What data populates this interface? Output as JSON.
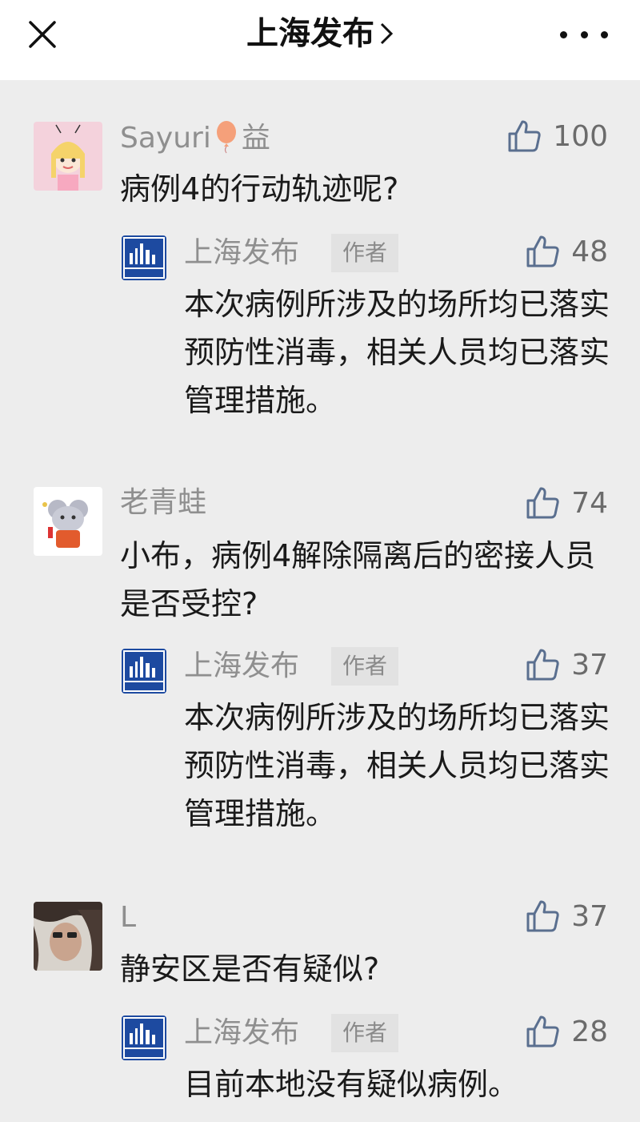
{
  "header": {
    "title": "上海发布",
    "close_icon": "close-icon",
    "more_icon": "more-dots-icon"
  },
  "colors": {
    "background": "#ededed",
    "topbar": "#ffffff",
    "name": "#8f8f8f",
    "text": "#1a1a1a",
    "badge_bg": "#e2e2e2"
  },
  "comments": [
    {
      "user": "Sayuri",
      "user_suffix": "益",
      "text": "病例4的行动轨迹呢?",
      "likes": "100",
      "reply": {
        "user": "上海发布",
        "badge": "作者",
        "text": "本次病例所涉及的场所均已落实预防性消毒，相关人员均已落实管理措施。",
        "likes": "48"
      }
    },
    {
      "user": "老青蛙",
      "text": "小布，病例4解除隔离后的密接人员是否受控?",
      "likes": "74",
      "reply": {
        "user": "上海发布",
        "badge": "作者",
        "text": "本次病例所涉及的场所均已落实预防性消毒，相关人员均已落实管理措施。",
        "likes": "37"
      }
    },
    {
      "user": "L",
      "text": "静安区是否有疑似?",
      "likes": "37",
      "reply": {
        "user": "上海发布",
        "badge": "作者",
        "text": "目前本地没有疑似病例。",
        "likes": "28"
      }
    }
  ]
}
